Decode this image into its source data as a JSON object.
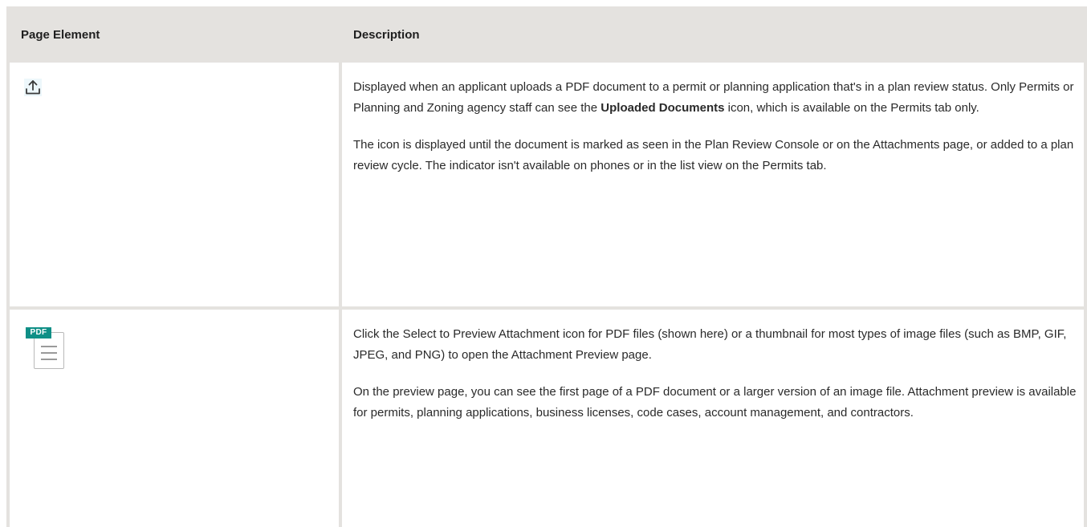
{
  "table": {
    "headers": {
      "element": "Page Element",
      "description": "Description"
    },
    "rows": [
      {
        "icon": "upload-icon",
        "paragraphs": [
          {
            "before": "Displayed when an applicant uploads a PDF document to a permit or planning application that's in a plan review status. Only Permits or Planning and Zoning agency staff can see the ",
            "bold": "Uploaded Documents",
            "after": " icon, which is available on the Permits tab only."
          },
          {
            "text": "The icon is displayed until the document is marked as seen in the Plan Review Console or on the Attachments page, or added to a plan review cycle. The indicator isn't available on phones or in the list view on the Permits tab."
          }
        ]
      },
      {
        "icon": "pdf-file-icon",
        "icon_badge": "PDF",
        "paragraphs": [
          {
            "text": "Click the Select to Preview Attachment icon for PDF files (shown here) or a thumbnail for most types of image files (such as BMP, GIF, JPEG, and PNG) to open the Attachment Preview page."
          },
          {
            "text": "On the preview page, you can see the first page of a PDF document or a larger version of an image file. Attachment preview is available for permits, planning applications, business licenses,  code cases, account management, and contractors."
          }
        ]
      }
    ]
  },
  "colors": {
    "border": "#e4e2df",
    "header_bg": "#e4e2df",
    "pdf_badge": "#0f8f86",
    "icon_stroke": "#3a3a3a",
    "icon_accent": "#dff0f8"
  }
}
